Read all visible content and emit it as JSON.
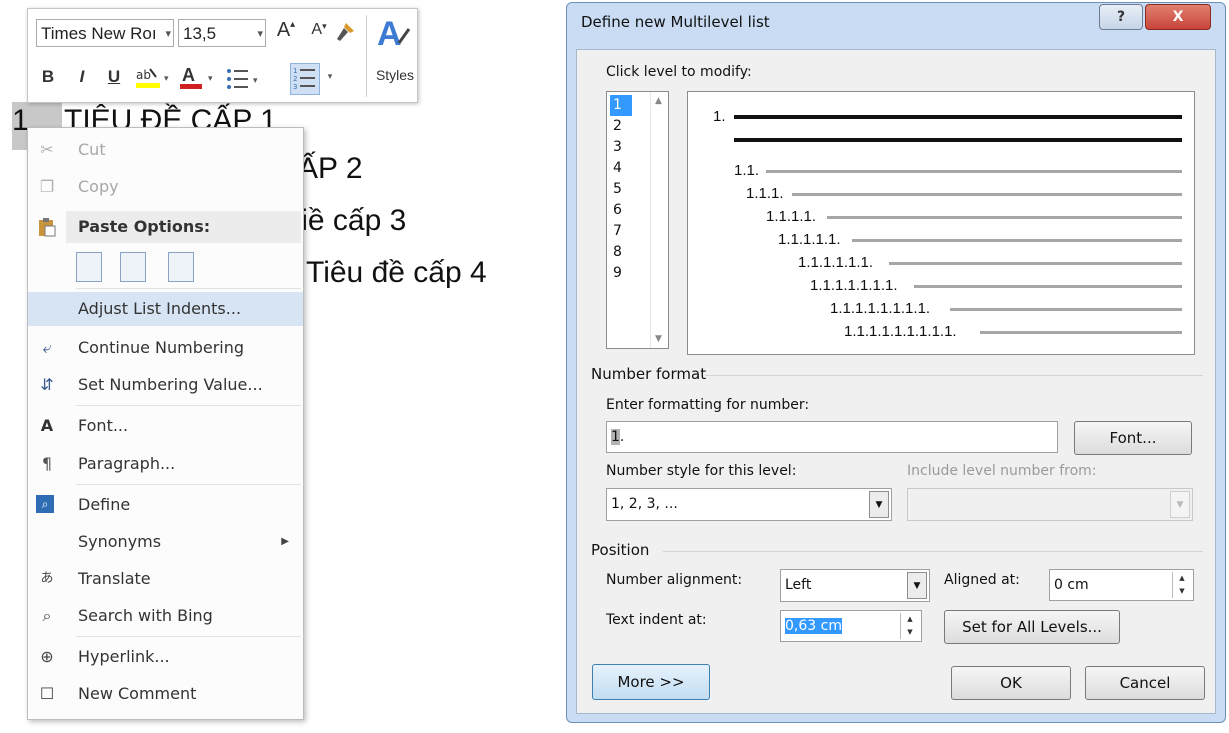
{
  "mini_toolbar": {
    "font_name": "Times New Roı",
    "font_size": "13,5",
    "grow_font_label": "A",
    "shrink_font_label": "A",
    "styles_label": "Styles",
    "bold_label": "B",
    "italic_label": "I",
    "underline_label": "U",
    "font_color_label": "A"
  },
  "document": {
    "lines": [
      "TIÊU ĐỀ CẤP 1",
      "ẤP 2",
      "Tiề cấp 3",
      "Tiêu đề cấp 4"
    ],
    "first_number": "1"
  },
  "context_menu": {
    "cut": "Cut",
    "copy": "Copy",
    "paste_options": "Paste Options:",
    "adjust_list_indents": "Adjust List Indents...",
    "continue_numbering": "Continue Numbering",
    "set_numbering_value": "Set Numbering Value...",
    "font": "Font...",
    "paragraph": "Paragraph...",
    "define": "Define",
    "synonyms": "Synonyms",
    "translate": "Translate",
    "search_with_bing": "Search with Bing",
    "hyperlink": "Hyperlink...",
    "new_comment": "New Comment"
  },
  "dialog": {
    "title": "Define new Multilevel list",
    "help_label": "?",
    "close_label": "X",
    "click_level_label": "Click level to modify:",
    "levels": [
      "1",
      "2",
      "3",
      "4",
      "5",
      "6",
      "7",
      "8",
      "9"
    ],
    "preview_numbers": [
      "1.",
      "1.1.",
      "1.1.1.",
      "1.1.1.1.",
      "1.1.1.1.1.",
      "1.1.1.1.1.1.",
      "1.1.1.1.1.1.1.",
      "1.1.1.1.1.1.1.1.",
      "1.1.1.1.1.1.1.1.1."
    ],
    "number_format_header": "Number format",
    "enter_formatting_label": "Enter formatting for number:",
    "formatting_selected": "1",
    "formatting_rest": ".",
    "font_button": "Font...",
    "number_style_label": "Number style for this level:",
    "number_style_value": "1, 2, 3, ...",
    "include_level_label": "Include level number from:",
    "position_header": "Position",
    "number_alignment_label": "Number alignment:",
    "number_alignment_value": "Left",
    "aligned_at_label": "Aligned at:",
    "aligned_at_value": "0 cm",
    "text_indent_label": "Text indent at:",
    "text_indent_value": "0,63 cm",
    "set_all_levels_button": "Set for All Levels...",
    "more_button": "More >>",
    "ok_button": "OK",
    "cancel_button": "Cancel"
  },
  "colors": {
    "selection_blue": "#3399ff",
    "dialog_frame": "#c9dcf3",
    "close_red": "#c9443a",
    "menu_highlight": "#d6e4f3"
  }
}
